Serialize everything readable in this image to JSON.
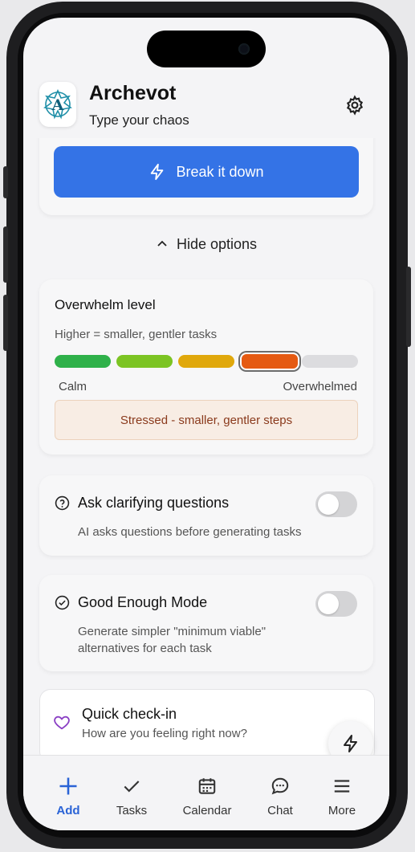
{
  "header": {
    "title": "Archevot",
    "subtitle": "Type your chaos"
  },
  "break_button": {
    "label": "Break it down"
  },
  "hide_options": {
    "label": "Hide options"
  },
  "overwhelm": {
    "title": "Overwhelm level",
    "subtitle": "Higher = smaller, gentler tasks",
    "min_label": "Calm",
    "max_label": "Overwhelmed",
    "levels": [
      {
        "color": "#2fb14a"
      },
      {
        "color": "#7cc423"
      },
      {
        "color": "#e0a80c"
      },
      {
        "color": "#e55a12"
      },
      {
        "color": "#dcdcdf"
      }
    ],
    "selected_level": 4,
    "status": "Stressed - smaller, gentler steps"
  },
  "options": [
    {
      "label": "Ask clarifying questions",
      "description": "AI asks questions before generating tasks",
      "enabled": false
    },
    {
      "label": "Good Enough Mode",
      "description": "Generate simpler \"minimum viable\" alternatives for each task",
      "enabled": false
    }
  ],
  "checkin": {
    "title": "Quick check-in",
    "subtitle": "How are you feeling right now?"
  },
  "nav": [
    {
      "label": "Add",
      "icon": "plus-icon",
      "active": true
    },
    {
      "label": "Tasks",
      "icon": "check-icon",
      "active": false
    },
    {
      "label": "Calendar",
      "icon": "calendar-icon",
      "active": false
    },
    {
      "label": "Chat",
      "icon": "chat-icon",
      "active": false
    },
    {
      "label": "More",
      "icon": "menu-icon",
      "active": false
    }
  ],
  "colors": {
    "accent": "#3473e6",
    "nav_active": "#2a63d6",
    "logo": "#1f8fa8"
  }
}
